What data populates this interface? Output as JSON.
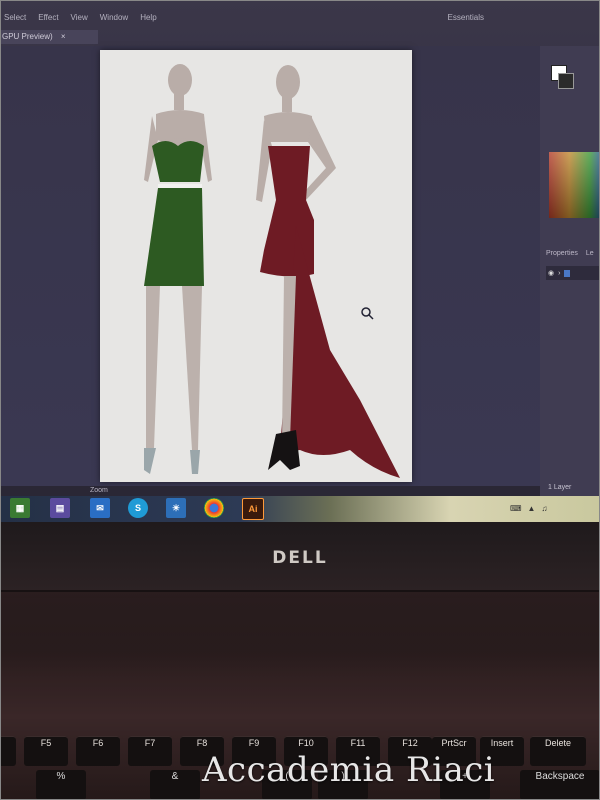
{
  "app": {
    "menu": [
      "Select",
      "Effect",
      "View",
      "Window",
      "Help"
    ],
    "workspace": "Essentials",
    "tab_label": "GPU Preview)",
    "tab_close": "×",
    "zoom_label": "Zoom",
    "layers_count": "1 Layer",
    "panel_tabs": [
      "Properties",
      "Le"
    ]
  },
  "taskbar": {
    "icons": [
      "windows-store-icon",
      "calculator-icon",
      "mail-icon",
      "skype-icon",
      "settings-icon",
      "chrome-icon",
      "illustrator-icon"
    ],
    "illustrator_label": "Ai"
  },
  "laptop": {
    "brand": "DELL"
  },
  "keyboard": {
    "fkeys": [
      "F5",
      "F6",
      "F7",
      "F8",
      "F9",
      "F10",
      "F11",
      "F12",
      "PrtScr",
      "Insert",
      "Delete"
    ],
    "bottom_keys": [
      "%",
      "&",
      "(",
      ")",
      "+",
      "Backspace"
    ]
  },
  "watermark": "Accademia Riaci",
  "colors": {
    "green_dress": "#2d5a22",
    "red_gown": "#6e1b24",
    "artboard": "#e7e6e4",
    "skin": "#b8aca6"
  }
}
